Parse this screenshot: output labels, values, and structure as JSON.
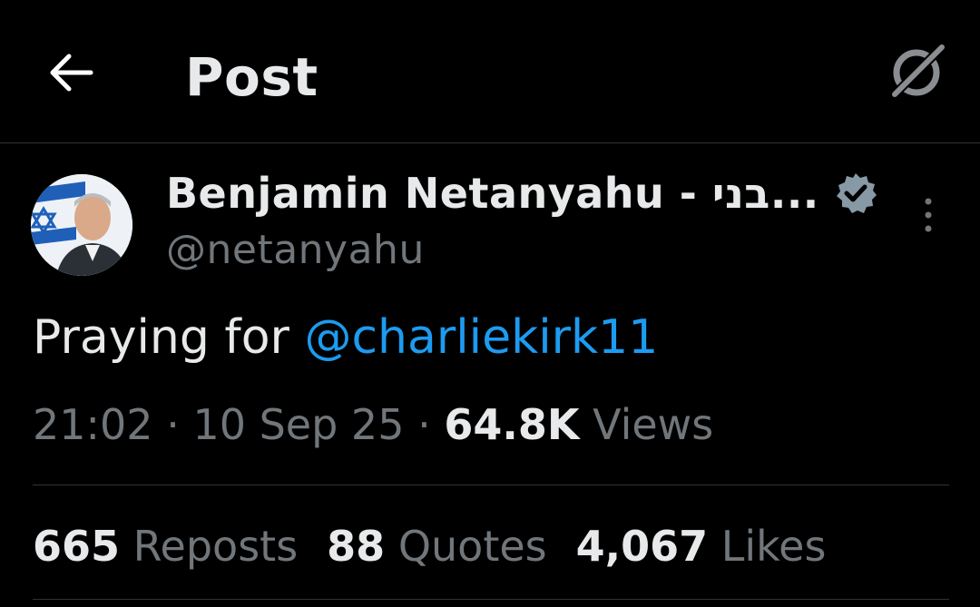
{
  "header": {
    "title": "Post",
    "back_icon": "arrow-left-icon",
    "grok_icon": "grok-icon"
  },
  "post": {
    "author": {
      "display_name": "Benjamin Netanyahu - בני...",
      "handle": "@netanyahu",
      "verified": true,
      "verified_color": "#8899a6"
    },
    "text_prefix": "Praying for ",
    "mention": "@charliekirk11",
    "time": "21:02",
    "date": "10 Sep 25",
    "views_count": "64.8K",
    "views_label": "Views",
    "separator": "·"
  },
  "stats": {
    "reposts_count": "665",
    "reposts_label": "Reposts",
    "quotes_count": "88",
    "quotes_label": "Quotes",
    "likes_count": "4,067",
    "likes_label": "Likes"
  },
  "colors": {
    "background": "#000000",
    "primary_text": "#e7e9ea",
    "secondary_text": "#71767b",
    "link": "#1d9bf0",
    "border": "#2f3336"
  }
}
